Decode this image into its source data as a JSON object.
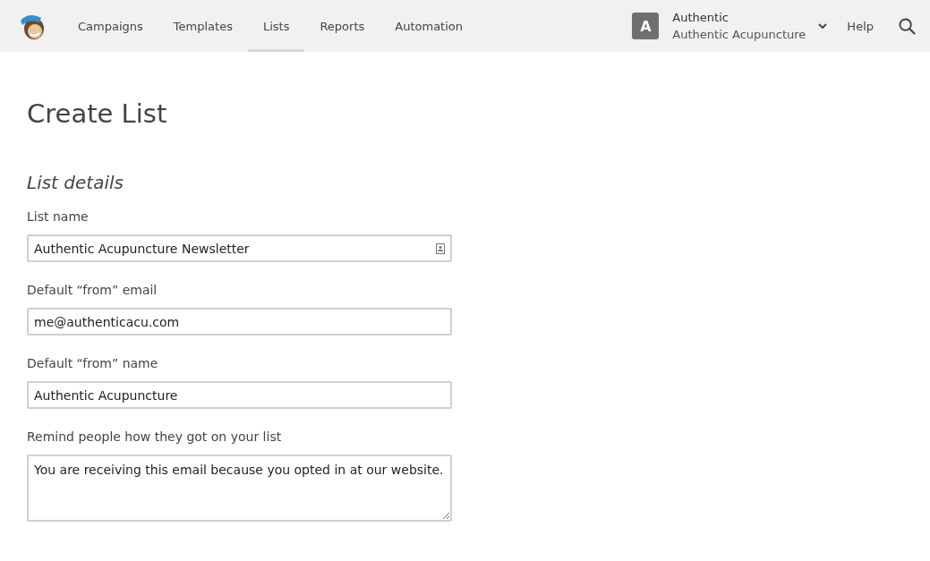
{
  "nav": {
    "items": [
      {
        "label": "Campaigns",
        "selected": false
      },
      {
        "label": "Templates",
        "selected": false
      },
      {
        "label": "Lists",
        "selected": true
      },
      {
        "label": "Reports",
        "selected": false
      },
      {
        "label": "Automation",
        "selected": false
      }
    ]
  },
  "account": {
    "avatar": "A",
    "name": "Authentic",
    "organization": "Authentic Acupuncture"
  },
  "help": "Help",
  "page": {
    "title": "Create List",
    "section": "List details"
  },
  "fields": [
    {
      "kind": "input",
      "label": "List name",
      "value": "Authentic Acupuncture Newsletter",
      "contact_icon": true
    },
    {
      "kind": "input",
      "label": "Default “from” email",
      "value": "me@authenticacu.com",
      "contact_icon": false
    },
    {
      "kind": "input",
      "label": "Default “from” name",
      "value": "Authentic Acupuncture",
      "contact_icon": false
    },
    {
      "kind": "textarea",
      "label": "Remind people how they got on your list",
      "value": "You are receiving this email because you opted in at our website."
    }
  ]
}
